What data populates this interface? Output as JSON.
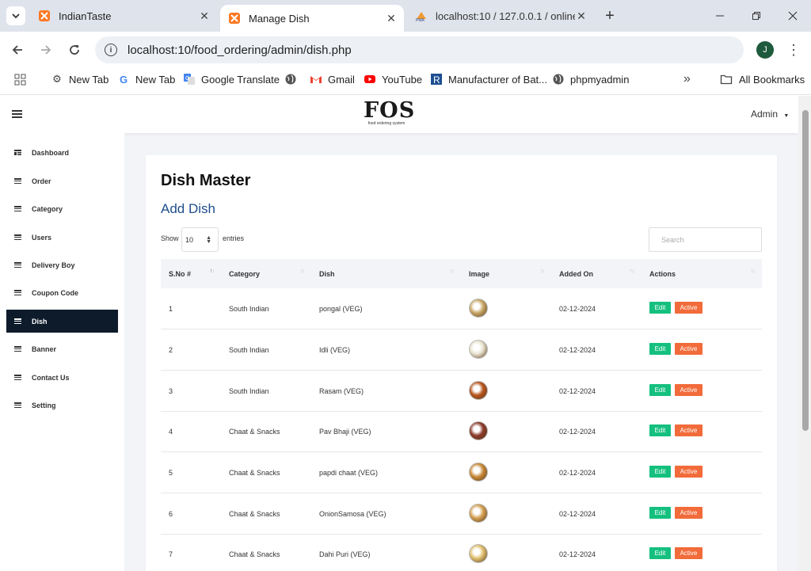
{
  "browser": {
    "tabs": [
      {
        "title": "IndianTaste",
        "active": false
      },
      {
        "title": "Manage Dish",
        "active": true
      },
      {
        "title": "localhost:10 / 127.0.0.1 / online",
        "active": false
      }
    ],
    "url": "localhost:10/food_ordering/admin/dish.php",
    "profile_initial": "J",
    "bookmarks": [
      {
        "label": "New Tab",
        "icon": "gear-icon"
      },
      {
        "label": "New Tab",
        "icon": "google-icon"
      },
      {
        "label": "Google Translate",
        "icon": "translate-icon"
      },
      {
        "label": "",
        "icon": "globe-icon"
      },
      {
        "label": "Gmail",
        "icon": "gmail-icon"
      },
      {
        "label": "YouTube",
        "icon": "youtube-icon"
      },
      {
        "label": "Manufacturer of Bat...",
        "icon": "r-icon"
      },
      {
        "label": "phpmyadmin",
        "icon": "globe-icon"
      }
    ],
    "all_bookmarks": "All Bookmarks"
  },
  "app": {
    "logo_text": "FOS",
    "logo_subtext": "food ordering system",
    "admin_label": "Admin",
    "sidebar": [
      {
        "label": "Dashboard",
        "icon": "dashboard-icon"
      },
      {
        "label": "Order",
        "icon": "list-icon"
      },
      {
        "label": "Category",
        "icon": "list-icon"
      },
      {
        "label": "Users",
        "icon": "list-icon"
      },
      {
        "label": "Delivery Boy",
        "icon": "list-icon"
      },
      {
        "label": "Coupon Code",
        "icon": "list-icon"
      },
      {
        "label": "Dish",
        "icon": "list-icon",
        "active": true
      },
      {
        "label": "Banner",
        "icon": "list-icon"
      },
      {
        "label": "Contact Us",
        "icon": "list-icon"
      },
      {
        "label": "Setting",
        "icon": "list-icon"
      }
    ]
  },
  "main": {
    "title": "Dish Master",
    "add_link": "Add Dish",
    "show_label": "Show",
    "entries_value": "10",
    "entries_label": "entries",
    "search_placeholder": "Search",
    "columns": [
      "S.No #",
      "Category",
      "Dish",
      "Image",
      "Added On",
      "Actions"
    ],
    "rows": [
      {
        "sno": "1",
        "category": "South Indian",
        "dish": "pongal (VEG)",
        "image_color": "#c9a968",
        "added_on": "02-12-2024",
        "edit": "Edit",
        "status": "Active"
      },
      {
        "sno": "2",
        "category": "South Indian",
        "dish": "Idli (VEG)",
        "image_color": "#e8e2cf",
        "added_on": "02-12-2024",
        "edit": "Edit",
        "status": "Active"
      },
      {
        "sno": "3",
        "category": "South Indian",
        "dish": "Rasam (VEG)",
        "image_color": "#b8561e",
        "added_on": "02-12-2024",
        "edit": "Edit",
        "status": "Active"
      },
      {
        "sno": "4",
        "category": "Chaat & Snacks",
        "dish": "Pav Bhaji (VEG)",
        "image_color": "#8b3a2a",
        "added_on": "02-12-2024",
        "edit": "Edit",
        "status": "Active"
      },
      {
        "sno": "5",
        "category": "Chaat & Snacks",
        "dish": "papdi chaat (VEG)",
        "image_color": "#c98a3a",
        "added_on": "02-12-2024",
        "edit": "Edit",
        "status": "Active"
      },
      {
        "sno": "6",
        "category": "Chaat & Snacks",
        "dish": "OnionSamosa (VEG)",
        "image_color": "#d4a052",
        "added_on": "02-12-2024",
        "edit": "Edit",
        "status": "Active"
      },
      {
        "sno": "7",
        "category": "Chaat & Snacks",
        "dish": "Dahi Puri (VEG)",
        "image_color": "#e0c070",
        "added_on": "02-12-2024",
        "edit": "Edit",
        "status": "Active"
      }
    ]
  },
  "colors": {
    "sidebar_active": "#0d1b2a",
    "edit_button": "#15c07f",
    "status_button": "#f26b3a",
    "link": "#1e4e8c"
  }
}
